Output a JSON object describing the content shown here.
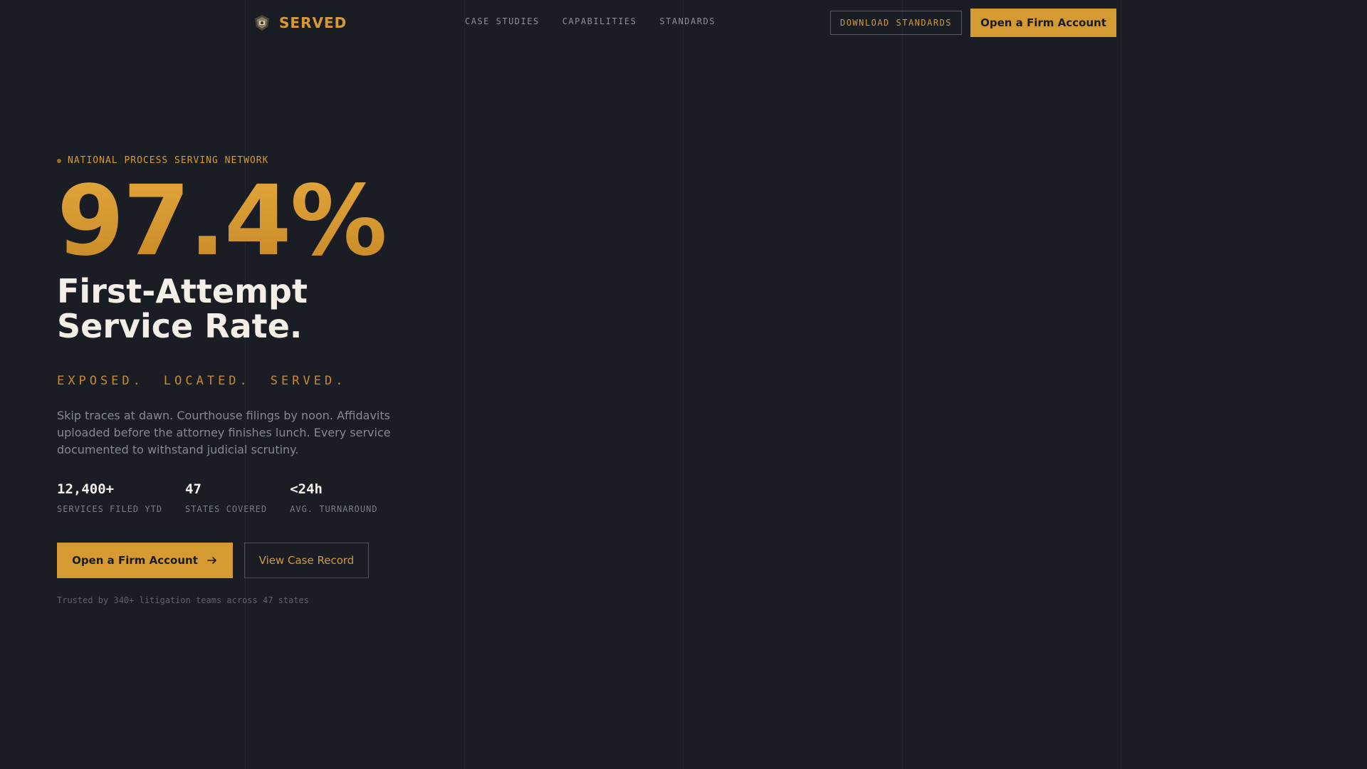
{
  "header": {
    "brand": "SERVED",
    "brand_icon": "shield-icon",
    "nav": [
      "CASE STUDIES",
      "CAPABILITIES",
      "STANDARDS"
    ],
    "download_label": "DOWNLOAD STANDARDS",
    "cta_label": "Open a Firm Account"
  },
  "hero": {
    "eyebrow": "NATIONAL PROCESS SERVING NETWORK",
    "big_stat": "97.4%",
    "headline": [
      "First-Attempt",
      "Service Rate."
    ],
    "tagline": [
      "EXPOSED.",
      "LOCATED.",
      "SERVED."
    ],
    "description": "Skip traces at dawn. Courthouse filings by noon. Affidavits uploaded before the attorney finishes lunch. Every service documented to withstand judicial scrutiny.",
    "stats": [
      {
        "value": "12,400+",
        "label": "SERVICES FILED YTD"
      },
      {
        "value": "47",
        "label": "STATES COVERED"
      },
      {
        "value": "<24h",
        "label": "AVG. TURNAROUND"
      }
    ],
    "primary_cta": "Open a Firm Account",
    "primary_cta_icon": "arrow-right-icon",
    "secondary_cta": "View Case Record",
    "trust": "Trusted by 340+ litigation teams across 47 states"
  },
  "colors": {
    "background": "#1b1d24",
    "accent": "#d69a33",
    "text": "#f3efe6",
    "muted": "#868993"
  }
}
